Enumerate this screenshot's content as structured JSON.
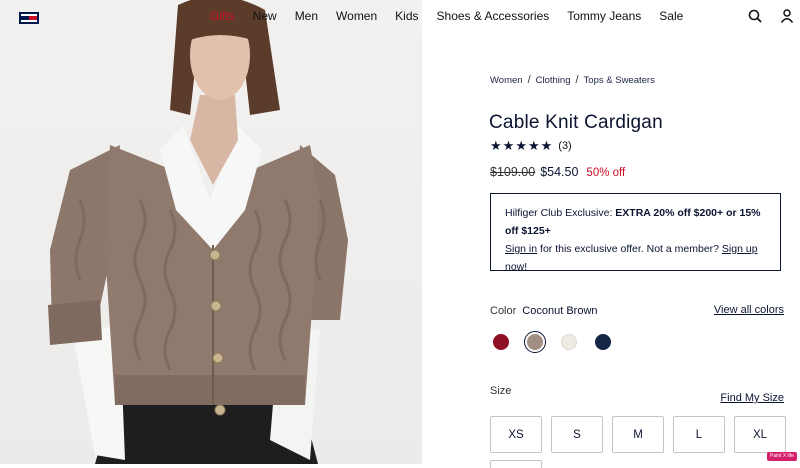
{
  "header": {
    "nav": [
      {
        "label": "Gifts",
        "highlight": true
      },
      {
        "label": "New",
        "highlight": false
      },
      {
        "label": "Men",
        "highlight": false
      },
      {
        "label": "Women",
        "highlight": false
      },
      {
        "label": "Kids",
        "highlight": false
      },
      {
        "label": "Shoes & Accessories",
        "highlight": false
      },
      {
        "label": "Tommy Jeans",
        "highlight": false
      },
      {
        "label": "Sale",
        "highlight": false
      }
    ],
    "icons": [
      "search-icon",
      "account-icon"
    ],
    "brand_colors": {
      "navy": "#00174f",
      "red": "#cd0f25",
      "white": "#ffffff"
    }
  },
  "breadcrumb": [
    "Women",
    "Clothing",
    "Tops & Sweaters"
  ],
  "product": {
    "title": "Cable Knit Cardigan",
    "rating_stars": 5,
    "review_count": "(3)",
    "original_price": "$109.00",
    "sale_price": "$54.50",
    "discount": "50% off"
  },
  "promo": {
    "prefix": "Hilfiger Club Exclusive: ",
    "offer": "EXTRA 20% off $200+ or 15% off $125+",
    "sign_in": "Sign in",
    "middle": " for this exclusive offer. Not a member? ",
    "sign_up": "Sign up",
    "suffix": " now!"
  },
  "color": {
    "label": "Color",
    "selected": "Coconut Brown",
    "view_all": "View all colors",
    "swatches": [
      {
        "name": "burgundy",
        "hex": "#8e1025",
        "selected": false
      },
      {
        "name": "coconut-brown",
        "hex": "#a18f82",
        "selected": true
      },
      {
        "name": "ivory",
        "hex": "#efebe2",
        "selected": false
      },
      {
        "name": "navy",
        "hex": "#162646",
        "selected": false
      }
    ]
  },
  "size": {
    "label": "Size",
    "find": "Find My Size",
    "options": [
      "XS",
      "S",
      "M",
      "L",
      "XL"
    ]
  },
  "badge": "Paint X lite"
}
